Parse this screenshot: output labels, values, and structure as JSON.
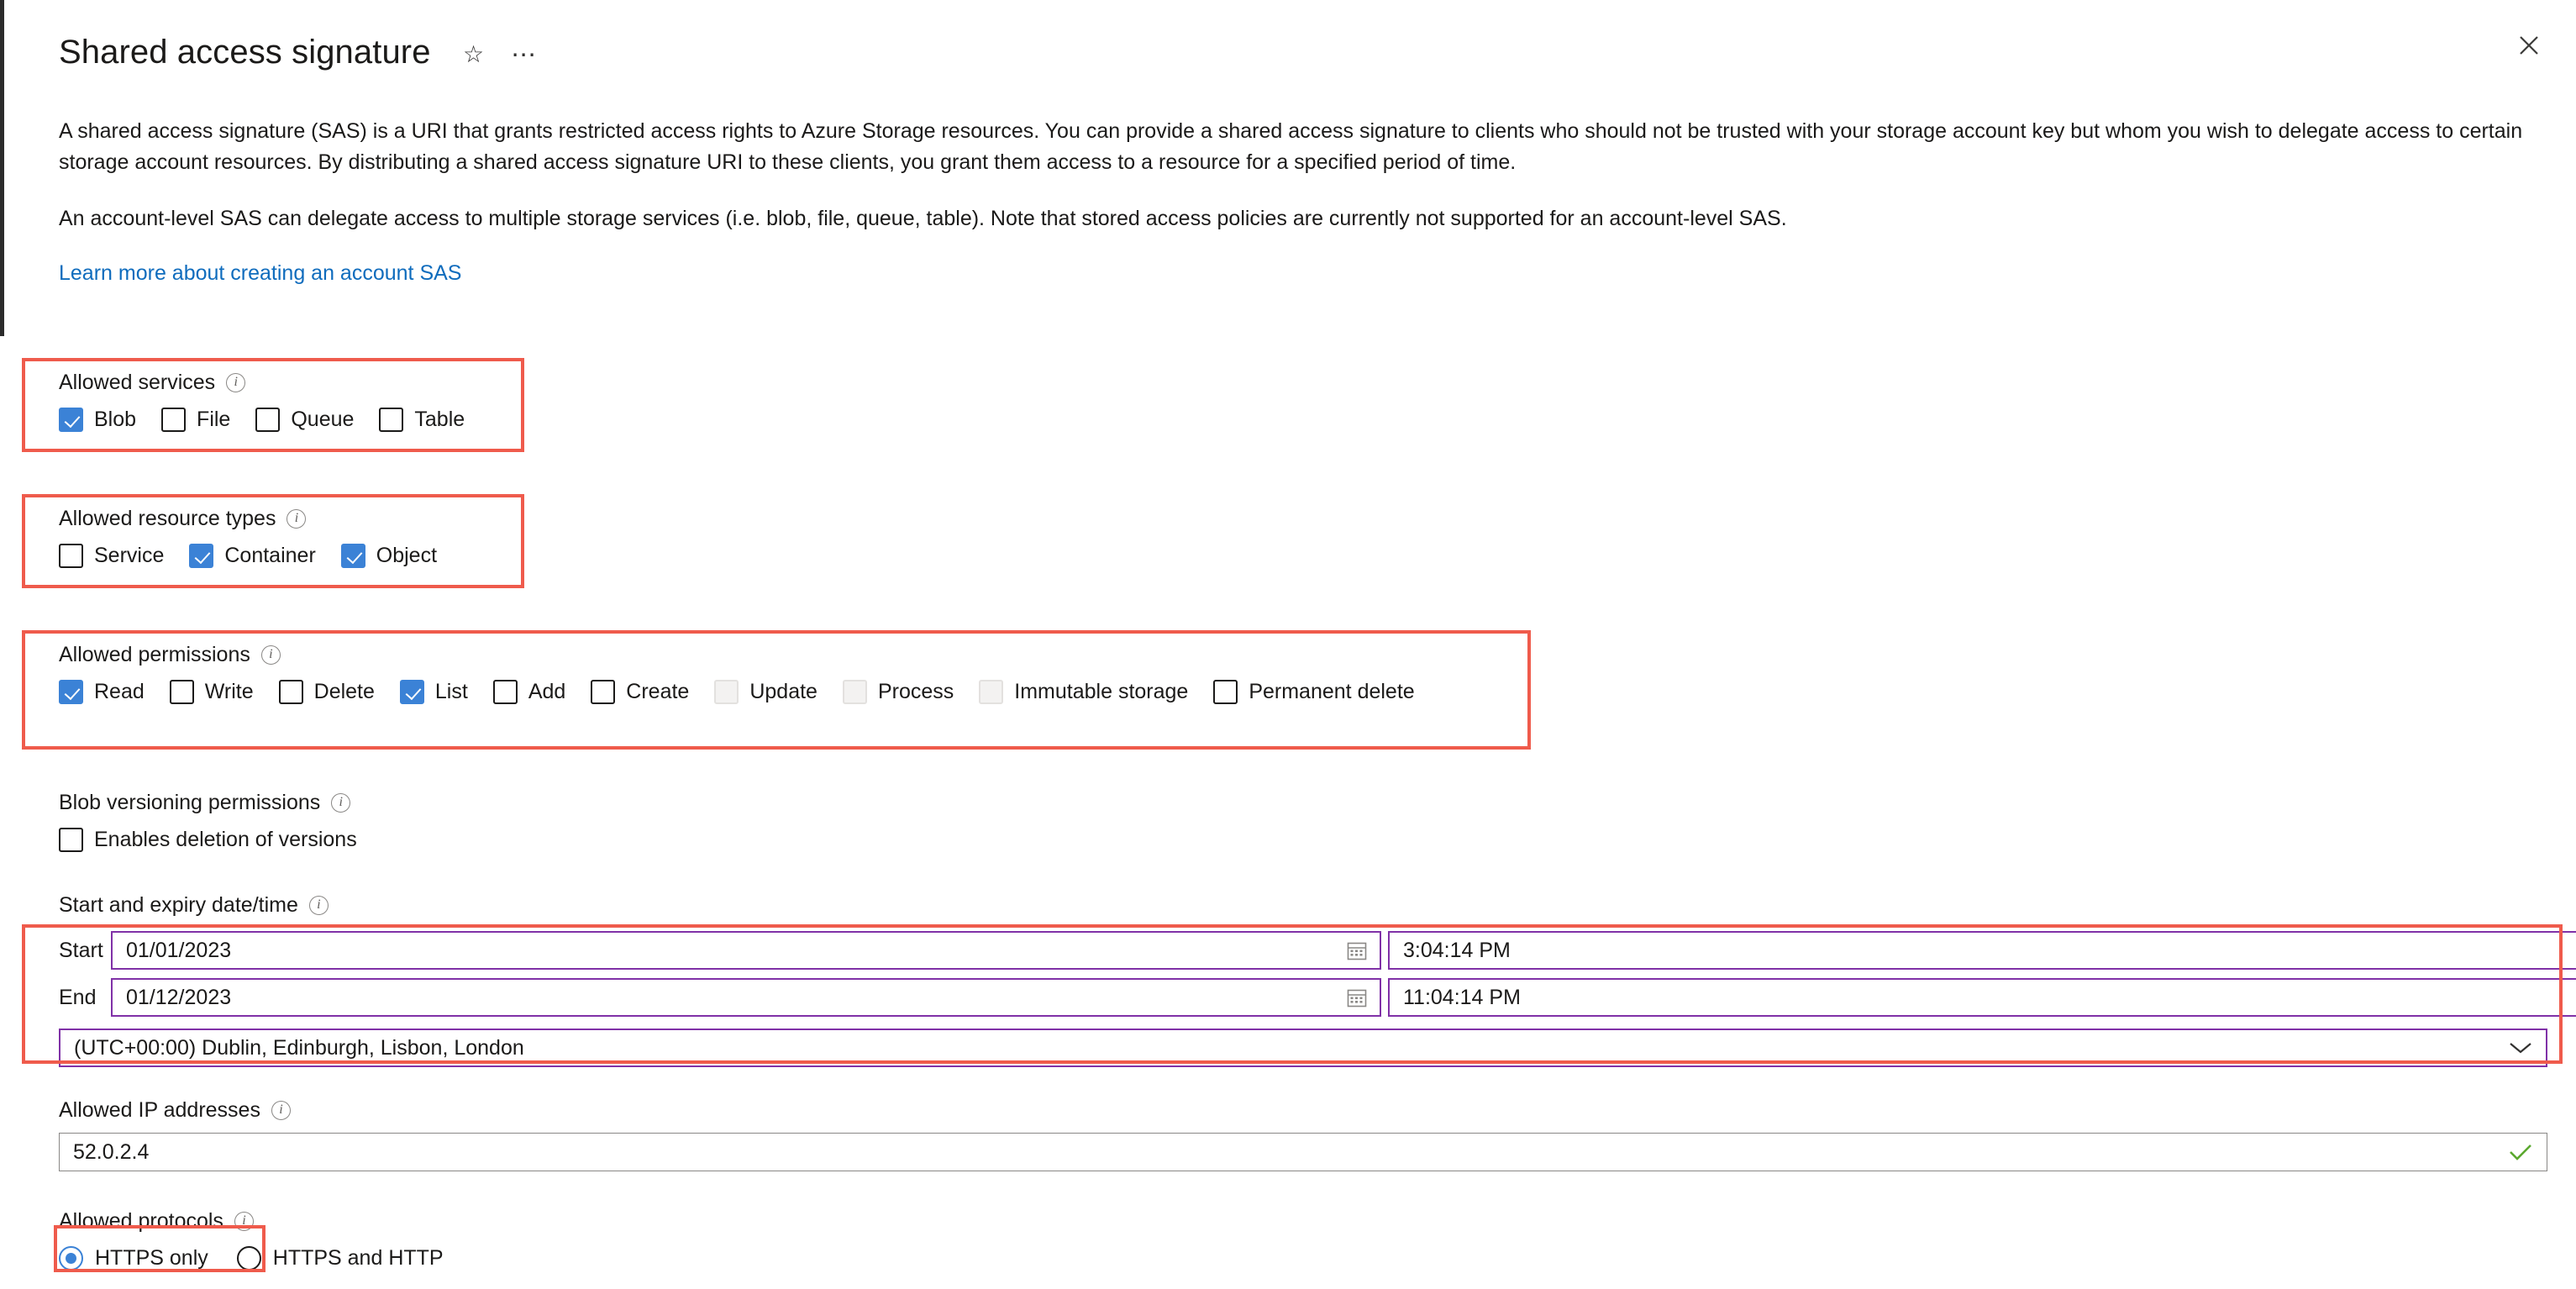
{
  "header": {
    "title": "Shared access signature",
    "favorite_icon": "star-icon",
    "more_icon": "ellipsis-icon",
    "close_icon": "close-icon"
  },
  "description": {
    "paragraph1": "A shared access signature (SAS) is a URI that grants restricted access rights to Azure Storage resources. You can provide a shared access signature to clients who should not be trusted with your storage account key but whom you wish to delegate access to certain storage account resources. By distributing a shared access signature URI to these clients, you grant them access to a resource for a specified period of time.",
    "paragraph2": "An account-level SAS can delegate access to multiple storage services (i.e. blob, file, queue, table). Note that stored access policies are currently not supported for an account-level SAS.",
    "learn_more_link": "Learn more about creating an account SAS"
  },
  "allowed_services": {
    "label": "Allowed services",
    "info_icon": "info-icon",
    "options": [
      {
        "label": "Blob",
        "checked": true,
        "disabled": false
      },
      {
        "label": "File",
        "checked": false,
        "disabled": false
      },
      {
        "label": "Queue",
        "checked": false,
        "disabled": false
      },
      {
        "label": "Table",
        "checked": false,
        "disabled": false
      }
    ]
  },
  "allowed_resource_types": {
    "label": "Allowed resource types",
    "info_icon": "info-icon",
    "options": [
      {
        "label": "Service",
        "checked": false,
        "disabled": false
      },
      {
        "label": "Container",
        "checked": true,
        "disabled": false
      },
      {
        "label": "Object",
        "checked": true,
        "disabled": false
      }
    ]
  },
  "allowed_permissions": {
    "label": "Allowed permissions",
    "info_icon": "info-icon",
    "options": [
      {
        "label": "Read",
        "checked": true,
        "disabled": false
      },
      {
        "label": "Write",
        "checked": false,
        "disabled": false
      },
      {
        "label": "Delete",
        "checked": false,
        "disabled": false
      },
      {
        "label": "List",
        "checked": true,
        "disabled": false
      },
      {
        "label": "Add",
        "checked": false,
        "disabled": false
      },
      {
        "label": "Create",
        "checked": false,
        "disabled": false
      },
      {
        "label": "Update",
        "checked": false,
        "disabled": true
      },
      {
        "label": "Process",
        "checked": false,
        "disabled": true
      },
      {
        "label": "Immutable storage",
        "checked": false,
        "disabled": true
      },
      {
        "label": "Permanent delete",
        "checked": false,
        "disabled": false
      }
    ]
  },
  "blob_versioning_permissions": {
    "label": "Blob versioning permissions",
    "info_icon": "info-icon",
    "options": [
      {
        "label": "Enables deletion of versions",
        "checked": false,
        "disabled": false
      }
    ]
  },
  "start_expiry": {
    "label": "Start and expiry date/time",
    "info_icon": "info-icon",
    "start_label": "Start",
    "start_date": "01/01/2023",
    "start_time": "3:04:14 PM",
    "end_label": "End",
    "end_date": "01/12/2023",
    "end_time": "11:04:14 PM",
    "calendar_icon": "calendar-icon",
    "timezone": "(UTC+00:00) Dublin, Edinburgh, Lisbon, London",
    "timezone_chevron_icon": "chevron-down-icon"
  },
  "allowed_ip": {
    "label": "Allowed IP addresses",
    "info_icon": "info-icon",
    "value": "52.0.2.4",
    "valid_icon": "checkmark-icon"
  },
  "allowed_protocols": {
    "label": "Allowed protocols",
    "info_icon": "info-icon",
    "options": [
      {
        "label": "HTTPS only",
        "selected": true
      },
      {
        "label": "HTTPS and HTTP",
        "selected": false
      }
    ]
  },
  "colors": {
    "annotation_red": "#ef5b4c",
    "accent_blue": "#3b82d6",
    "link_blue": "#0f6cbd",
    "field_purple": "#8031a7",
    "valid_green": "#5ba82f"
  }
}
